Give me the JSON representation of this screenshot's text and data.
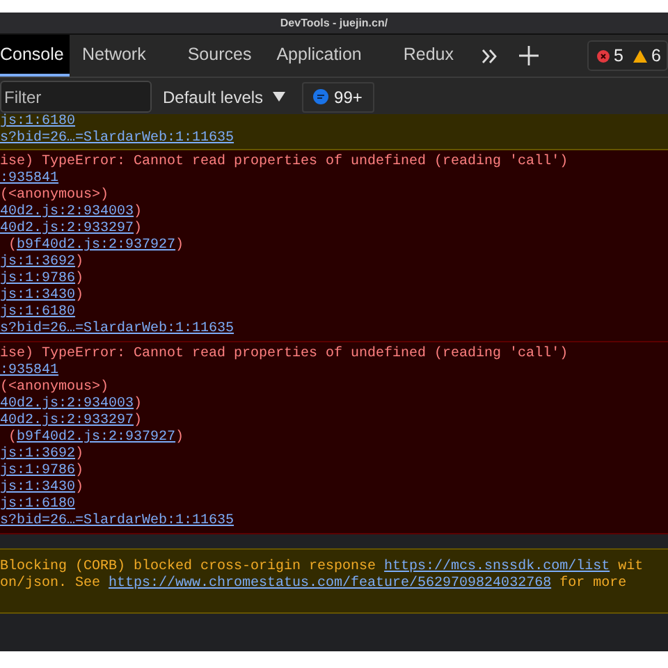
{
  "window": {
    "title": "DevTools - juejin.cn/"
  },
  "tabs": [
    {
      "label": "Console",
      "selected": true
    },
    {
      "label": "Network",
      "selected": false
    },
    {
      "label": "Sources",
      "selected": false
    },
    {
      "label": "Application",
      "selected": false
    },
    {
      "label": "Redux",
      "selected": false
    }
  ],
  "counts": {
    "errors": "5",
    "warnings": "6"
  },
  "toolbar": {
    "filter_placeholder": "Filter",
    "levels": "Default levels",
    "messages": "99+"
  },
  "messages": [
    {
      "kind": "warning",
      "lines": [
        [
          {
            "kind": "link",
            "text": "js:1:6180"
          }
        ],
        [
          {
            "kind": "link",
            "text": "s?bid=26…=SlardarWeb:1:11635"
          }
        ]
      ]
    },
    {
      "kind": "error",
      "lines": [
        [
          {
            "kind": "text",
            "text": "ise) TypeError: Cannot read properties of undefined (reading 'call')"
          }
        ],
        [
          {
            "kind": "link",
            "text": ":935841"
          }
        ],
        [
          {
            "kind": "text",
            "text": "(<anonymous>)"
          }
        ],
        [
          {
            "kind": "link",
            "text": "40d2.js:2:934003"
          },
          {
            "kind": "text",
            "text": ")"
          }
        ],
        [
          {
            "kind": "link",
            "text": "40d2.js:2:933297"
          },
          {
            "kind": "text",
            "text": ")"
          }
        ],
        [
          {
            "kind": "text",
            "text": " ("
          },
          {
            "kind": "link",
            "text": "b9f40d2.js:2:937927"
          },
          {
            "kind": "text",
            "text": ")"
          }
        ],
        [
          {
            "kind": "link",
            "text": "js:1:3692"
          },
          {
            "kind": "text",
            "text": ")"
          }
        ],
        [
          {
            "kind": "link",
            "text": "js:1:9786"
          },
          {
            "kind": "text",
            "text": ")"
          }
        ],
        [
          {
            "kind": "link",
            "text": "js:1:3430"
          },
          {
            "kind": "text",
            "text": ")"
          }
        ],
        [
          {
            "kind": "link",
            "text": "js:1:6180"
          }
        ],
        [
          {
            "kind": "link",
            "text": "s?bid=26…=SlardarWeb:1:11635"
          }
        ]
      ]
    },
    {
      "kind": "error",
      "lines": [
        [
          {
            "kind": "text",
            "text": "ise) TypeError: Cannot read properties of undefined (reading 'call')"
          }
        ],
        [
          {
            "kind": "link",
            "text": ":935841"
          }
        ],
        [
          {
            "kind": "text",
            "text": "(<anonymous>)"
          }
        ],
        [
          {
            "kind": "link",
            "text": "40d2.js:2:934003"
          },
          {
            "kind": "text",
            "text": ")"
          }
        ],
        [
          {
            "kind": "link",
            "text": "40d2.js:2:933297"
          },
          {
            "kind": "text",
            "text": ")"
          }
        ],
        [
          {
            "kind": "text",
            "text": " ("
          },
          {
            "kind": "link",
            "text": "b9f40d2.js:2:937927"
          },
          {
            "kind": "text",
            "text": ")"
          }
        ],
        [
          {
            "kind": "link",
            "text": "js:1:3692"
          },
          {
            "kind": "text",
            "text": ")"
          }
        ],
        [
          {
            "kind": "link",
            "text": "js:1:9786"
          },
          {
            "kind": "text",
            "text": ")"
          }
        ],
        [
          {
            "kind": "link",
            "text": "js:1:3430"
          },
          {
            "kind": "text",
            "text": ")"
          }
        ],
        [
          {
            "kind": "link",
            "text": "js:1:6180"
          }
        ],
        [
          {
            "kind": "link",
            "text": "s?bid=26…=SlardarWeb:1:11635"
          }
        ]
      ]
    },
    {
      "kind": "blank"
    },
    {
      "kind": "warning",
      "lines": [
        [
          {
            "kind": "text",
            "text": "Blocking (CORB) blocked cross-origin response "
          },
          {
            "kind": "link",
            "text": "https://mcs.snssdk.com/list"
          },
          {
            "kind": "text",
            "text": " wit"
          }
        ],
        [
          {
            "kind": "text",
            "text": "on/json. See "
          },
          {
            "kind": "link",
            "text": "https://www.chromestatus.com/feature/5629709824032768"
          },
          {
            "kind": "text",
            "text": " for more"
          }
        ]
      ]
    }
  ]
}
